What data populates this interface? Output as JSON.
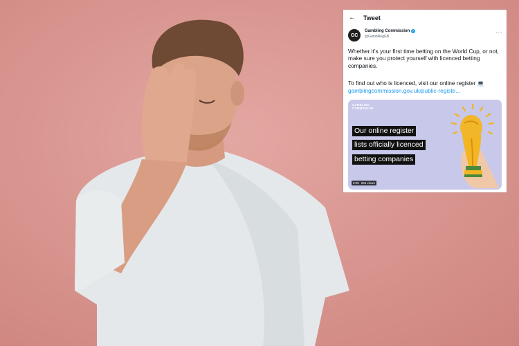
{
  "tweet": {
    "header_title": "Tweet",
    "author_initials": "GC",
    "author_name": "Gambling Commission",
    "author_handle": "@GambRegGB",
    "body_p1": "Whether it’s your first time betting on the World Cup, or not, make sure you protect yourself with licenced betting companies.",
    "body_p2": "To find out who is licenced, visit our online register",
    "body_emoji": "💻",
    "link_text": "gamblingcommission.gov.uk/public-registe...",
    "media": {
      "logo_line1": "GAMBLING",
      "logo_line2": "COMMISSION",
      "caption_line1": "Our online register",
      "caption_line2": "lists officially licenced",
      "caption_line3": "betting companies",
      "duration": "0:05",
      "views": "264 views"
    }
  },
  "icons": [
    "back-arrow-icon",
    "verified-badge-icon",
    "more-options-icon",
    "trophy-icon"
  ],
  "colors": {
    "background": "#d9938f",
    "link": "#1d9bf0",
    "media_background": "#c7c8ea"
  }
}
